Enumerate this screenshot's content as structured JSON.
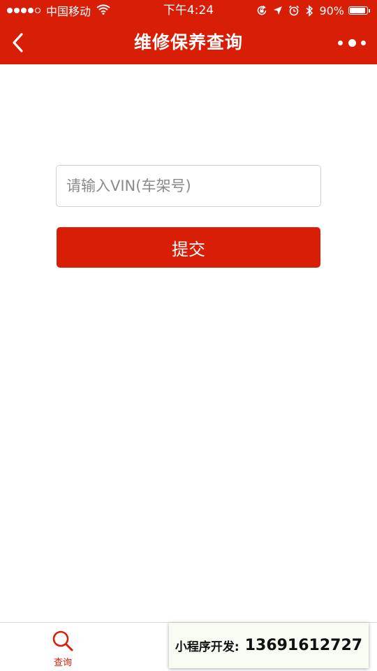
{
  "status_bar": {
    "carrier": "中国移动",
    "time": "下午4:24",
    "battery_percent": "90%",
    "battery_level": 0.9,
    "icons": [
      "signal-dots-icon",
      "wifi-icon",
      "orientation-lock-icon",
      "location-arrow-icon",
      "alarm-icon",
      "bluetooth-icon",
      "battery-icon"
    ]
  },
  "nav": {
    "title": "维修保养查询",
    "back_icon": "chevron-left-icon",
    "more_icon": "more-dots-icon"
  },
  "form": {
    "vin_placeholder": "请输入VIN(车架号)",
    "vin_value": "",
    "submit_label": "提交"
  },
  "tab_bar": {
    "items": [
      {
        "label": "查询",
        "icon": "search-icon",
        "active": true
      }
    ]
  },
  "promo": {
    "label": "小程序开发:",
    "phone": "13691612727"
  },
  "colors": {
    "brand": "#d81e06",
    "border": "#cfcfcf",
    "placeholder": "#8a8a8a"
  }
}
